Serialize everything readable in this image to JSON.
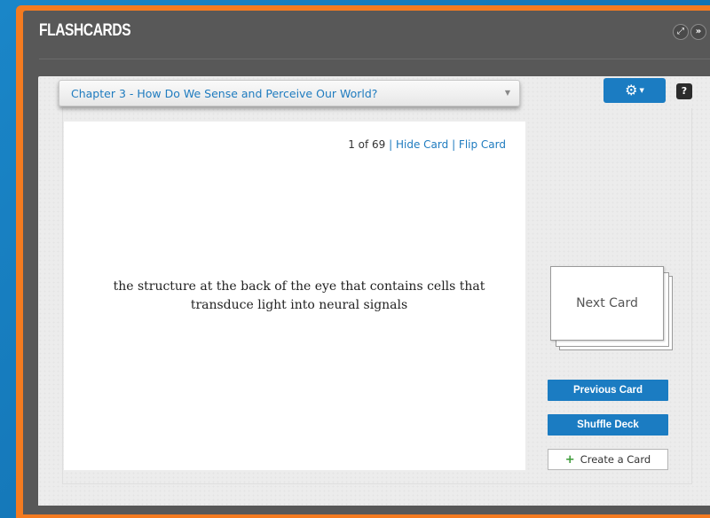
{
  "window": {
    "title": "FLASHCARDS",
    "expand_icon": "expand-icon",
    "collapse_icon": "double-chevron-right-icon"
  },
  "deck_select": {
    "value": "Chapter 3 - How Do We Sense and Perceive Our World?"
  },
  "settings": {
    "icon": "gear-icon"
  },
  "help": {
    "label": "?"
  },
  "card": {
    "position": "1 of 69",
    "hide_label": "Hide Card",
    "flip_label": "Flip Card",
    "text": "the structure at the back of the eye that contains cells that transduce light into neural signals"
  },
  "controls": {
    "next_label": "Next Card",
    "previous_label": "Previous Card",
    "shuffle_label": "Shuffle Deck",
    "create_label": "Create a Card"
  },
  "colors": {
    "accent": "#1b7cc2",
    "frame": "#f47b20",
    "panel": "#585858",
    "link": "#1e7bbf"
  }
}
